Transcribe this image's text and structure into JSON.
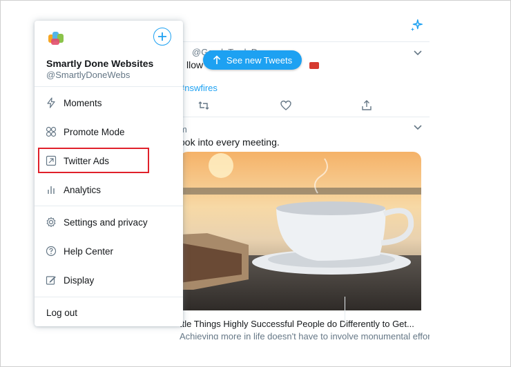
{
  "account": {
    "name": "Smartly Done Websites",
    "handle": "@SmartlyDoneWebs"
  },
  "menu": {
    "items": [
      {
        "label": "Moments",
        "icon": "lightning-icon"
      },
      {
        "label": "Promote Mode",
        "icon": "promote-icon"
      },
      {
        "label": "Twitter Ads",
        "icon": "external-arrow-icon"
      },
      {
        "label": "Analytics",
        "icon": "bar-chart-icon"
      },
      {
        "label": "Settings and privacy",
        "icon": "gear-icon"
      },
      {
        "label": "Help Center",
        "icon": "help-circle-icon"
      },
      {
        "label": "Display",
        "icon": "display-edit-icon"
      }
    ],
    "logout_label": "Log out"
  },
  "timeline": {
    "new_tweets_label": "See new Tweets",
    "tweet1": {
      "handle_fragment": "@GoodeTradeDe",
      "text_fragment": "llow",
      "hashtag": "#nswfires"
    },
    "tweet2": {
      "meta_fragment": "m",
      "text_fragment": "ook into every meeting.",
      "link_title": "ttle Things Highly Successful People do Differently to Get...",
      "link_desc": "Achieving more in life doesn't have to involve monumental effort."
    }
  },
  "colors": {
    "brand_blue": "#1da1f2",
    "highlight_red": "#e0202a",
    "muted_text": "#657786"
  }
}
